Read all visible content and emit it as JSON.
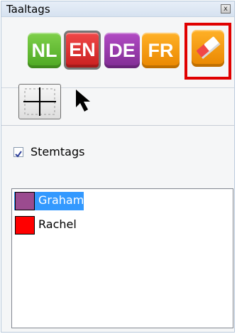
{
  "window": {
    "title": "Taaltags",
    "close_glyph": "x"
  },
  "languages": [
    {
      "code": "NL",
      "color": "#5cb82c"
    },
    {
      "code": "EN",
      "color": "#dd2f2f",
      "selected": true
    },
    {
      "code": "DE",
      "color": "#8d35a3"
    },
    {
      "code": "FR",
      "color": "#f39200"
    }
  ],
  "eraser": {
    "icon": "eraser-icon",
    "color": "#f39200",
    "highlighted": true
  },
  "tools": [
    {
      "icon": "crosshair-icon",
      "selected": true
    },
    {
      "icon": "arrow-pointer-icon",
      "selected": false
    }
  ],
  "stemtags": {
    "label": "Stemtags",
    "checked": true
  },
  "speakers": [
    {
      "name": "Graham",
      "color": "#9b4b8f",
      "selected": true
    },
    {
      "name": "Rachel",
      "color": "#ff0000",
      "selected": false
    }
  ]
}
